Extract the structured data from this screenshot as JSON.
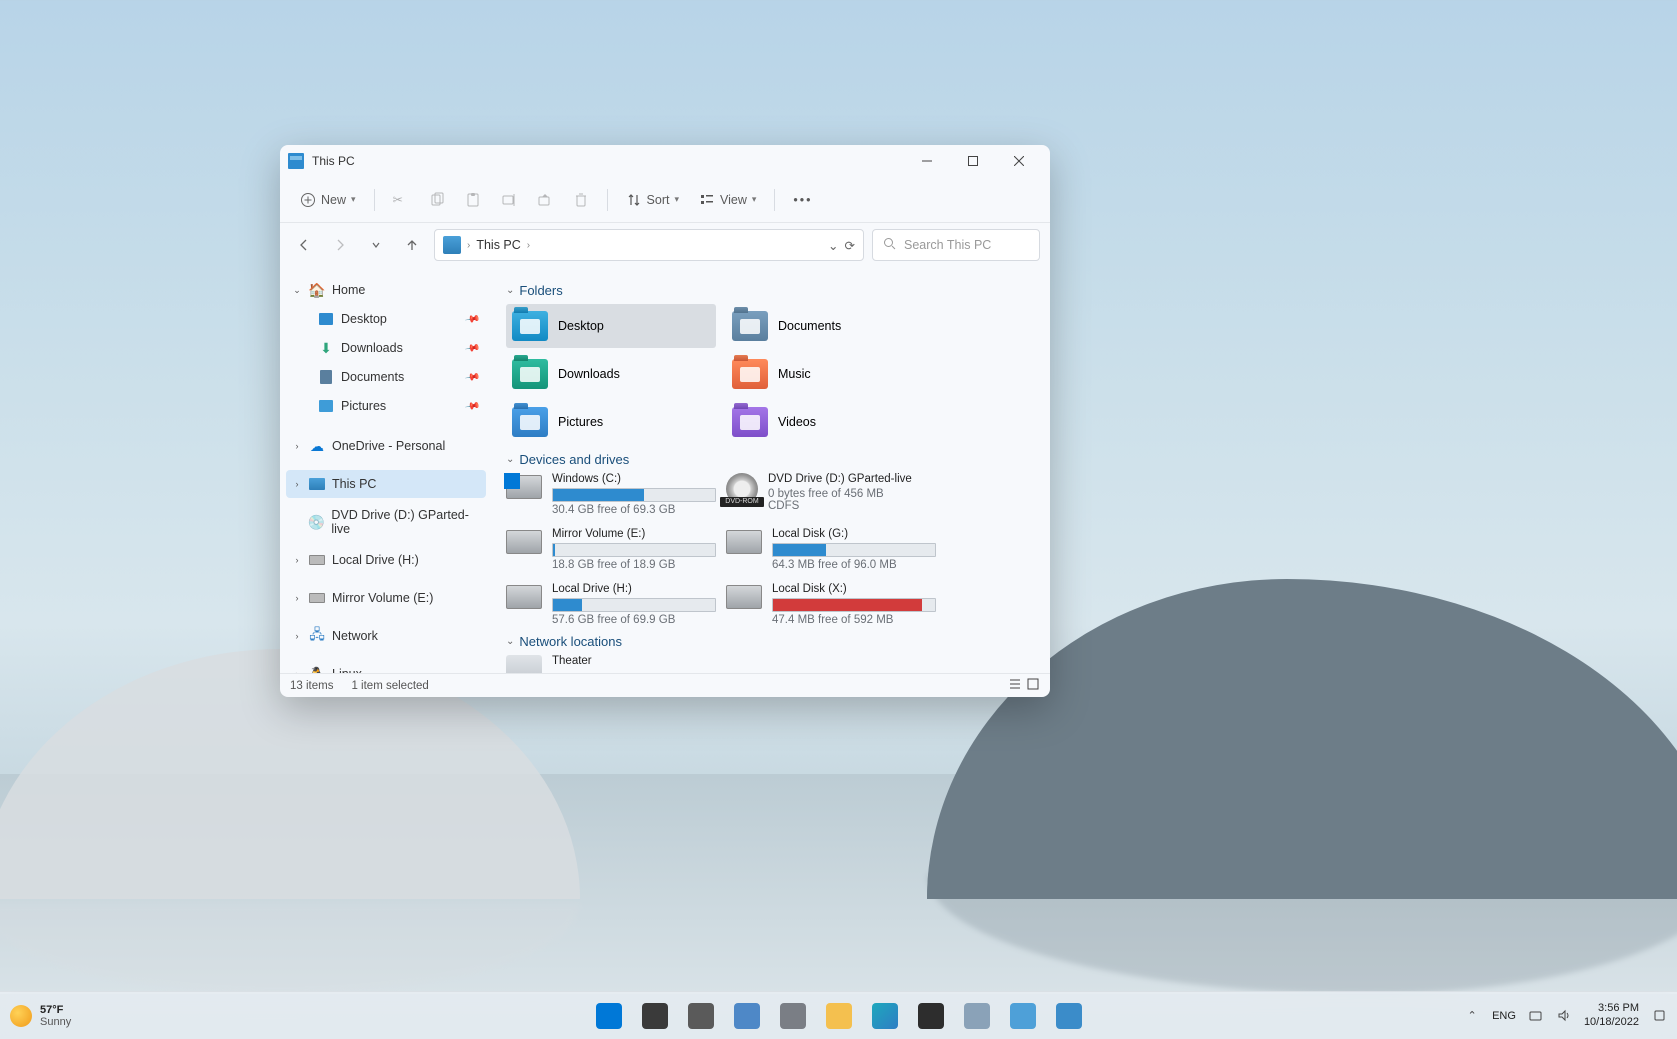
{
  "window": {
    "title": "This PC",
    "toolbar": {
      "new": "New",
      "sort": "Sort",
      "view": "View"
    },
    "address": {
      "location": "This PC"
    },
    "search": {
      "placeholder": "Search This PC"
    },
    "statusbar": {
      "items": "13 items",
      "selected": "1 item selected"
    }
  },
  "sidebar": {
    "home": "Home",
    "quick": [
      {
        "label": "Desktop",
        "pinned": true
      },
      {
        "label": "Downloads",
        "pinned": true
      },
      {
        "label": "Documents",
        "pinned": true
      },
      {
        "label": "Pictures",
        "pinned": true
      }
    ],
    "onedrive": "OneDrive - Personal",
    "thispc": "This PC",
    "dvd": "DVD Drive (D:) GParted-live",
    "localdrive": "Local Drive (H:)",
    "mirror": "Mirror Volume (E:)",
    "network": "Network",
    "linux": "Linux"
  },
  "sections": {
    "folders": "Folders",
    "drives": "Devices and drives",
    "network": "Network locations"
  },
  "folders": [
    {
      "label": "Desktop",
      "cls": "f-desktop",
      "sel": true
    },
    {
      "label": "Documents",
      "cls": "f-docs"
    },
    {
      "label": "Downloads",
      "cls": "f-down"
    },
    {
      "label": "Music",
      "cls": "f-music"
    },
    {
      "label": "Pictures",
      "cls": "f-pics"
    },
    {
      "label": "Videos",
      "cls": "f-video"
    }
  ],
  "drives": [
    {
      "name": "Windows (C:)",
      "free": "30.4 GB free of 69.3 GB",
      "pct": 56,
      "color": "#2e8bcf",
      "os": true
    },
    {
      "name": "DVD Drive (D:) GParted-live",
      "free": "0 bytes free of 456 MB",
      "extra": "CDFS",
      "dvd": true
    },
    {
      "name": "Mirror Volume (E:)",
      "free": "18.8 GB free of 18.9 GB",
      "pct": 1,
      "color": "#2e8bcf"
    },
    {
      "name": "Local Disk (G:)",
      "free": "64.3 MB free of 96.0 MB",
      "pct": 33,
      "color": "#2e8bcf"
    },
    {
      "name": "Local Drive (H:)",
      "free": "57.6 GB free of 69.9 GB",
      "pct": 18,
      "color": "#2e8bcf"
    },
    {
      "name": "Local Disk (X:)",
      "free": "47.4 MB free of 592 MB",
      "pct": 92,
      "color": "#d23b3b"
    }
  ],
  "network": [
    {
      "name": "Theater"
    }
  ],
  "taskbar": {
    "weather": {
      "temp": "57°F",
      "cond": "Sunny"
    },
    "apps": [
      {
        "name": "start",
        "bg": "#0078d7"
      },
      {
        "name": "search",
        "bg": "#3a3a3a"
      },
      {
        "name": "task-view",
        "bg": "#5a5a5a"
      },
      {
        "name": "widgets",
        "bg": "#4e88c7"
      },
      {
        "name": "settings",
        "bg": "#7a7e85"
      },
      {
        "name": "file-explorer",
        "bg": "#f4c04f"
      },
      {
        "name": "edge",
        "bg": "linear-gradient(135deg,#1ea8bd,#2e7dc4)"
      },
      {
        "name": "terminal",
        "bg": "#2d2d2d"
      },
      {
        "name": "dev-home",
        "bg": "#8aa2b8"
      },
      {
        "name": "notepad",
        "bg": "#4ea0d8"
      },
      {
        "name": "camera",
        "bg": "#3b8cc9"
      }
    ],
    "lang": "ENG",
    "time": "3:56 PM",
    "date": "10/18/2022"
  }
}
